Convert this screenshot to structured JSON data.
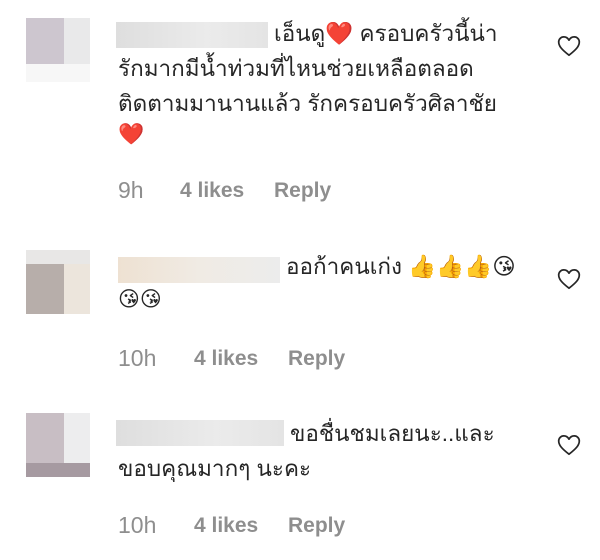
{
  "comments": [
    {
      "line1": "เอ็นดู❤️ ครอบครัวนี้น่า",
      "line2": "รักมากมีน้ำท่วมที่ไหนช่วยเหลือตลอด",
      "line3": "ติดตามมานานแล้ว รักครอบครัวศิลาชัย",
      "line4": "❤️",
      "time": "9h",
      "likes": "4 likes",
      "reply": "Reply",
      "like_icon": "heart-outline-icon"
    },
    {
      "line1": "ออก้าคนเก่ง 👍👍👍😘",
      "line2": "😘😘",
      "time": "10h",
      "likes": "4 likes",
      "reply": "Reply",
      "like_icon": "heart-outline-icon"
    },
    {
      "line1": "ขอชื่นชมเลยนะ..และ",
      "line2": "ขอบคุณมากๆ นะคะ",
      "time": "10h",
      "likes": "4 likes",
      "reply": "Reply",
      "like_icon": "heart-outline-icon"
    }
  ],
  "colors": {
    "text": "#262626",
    "meta": "#8e8e8e",
    "heart_outline": "#262626"
  }
}
